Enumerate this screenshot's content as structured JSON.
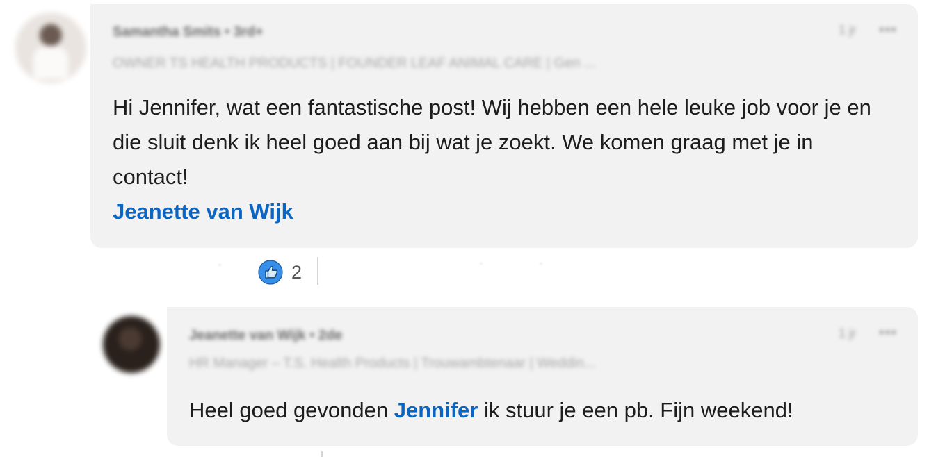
{
  "comment_1": {
    "author_name": "Samantha Smits",
    "connection_degree": "• 3rd+",
    "author_headline": "OWNER TS HEALTH PRODUCTS | FOUNDER LEAF ANIMAL CARE | Gen ...",
    "timestamp": "1 jr",
    "more": "•••",
    "text": "Hi Jennifer, wat een fantastische post! Wij hebben een hele leuke job voor je en die sluit denk ik heel goed aan bij wat je zoekt. We komen graag met je in contact!",
    "mention": "Jeanette van Wijk",
    "reactions": {
      "icon": "thumbs-up-icon",
      "count": "2"
    }
  },
  "comment_2": {
    "author_name": "Jeanette van Wijk",
    "connection_degree": "• 2de",
    "author_headline": "HR Manager – T.S. Health Products | Trouwambtenaar | Weddin...",
    "timestamp": "1 jr",
    "more": "•••",
    "text_before": "Heel goed gevonden ",
    "mention": "Jennifer",
    "text_after": " ik stuur je een pb. Fijn weekend!"
  },
  "colors": {
    "bubble": "#f2f2f2",
    "mention": "#0a66c2",
    "like_icon": "#378fe9"
  }
}
